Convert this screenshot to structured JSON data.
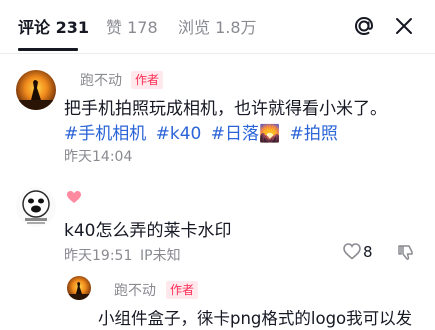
{
  "header": {
    "tabs": [
      {
        "label": "评论 231",
        "active": true
      },
      {
        "label": "赞 178",
        "active": false
      },
      {
        "label": "浏览 1.8万",
        "active": false
      }
    ],
    "icons": {
      "at": "at-icon",
      "close": "close-icon"
    }
  },
  "comments": [
    {
      "author": "跑不动",
      "author_tag": "作者",
      "text": "把手机拍照玩成相机，也许就得看小米了。",
      "hashtags": [
        "#手机相机",
        "#k40",
        "#日落🌄",
        "#拍照"
      ],
      "time": "昨天14:04"
    },
    {
      "avatar_icon": "meme-face-icon",
      "author": "",
      "text": "k40怎么弄的莱卡水印",
      "time": "昨天19:51",
      "location": "IP未知",
      "like_count": "8"
    }
  ],
  "reply": {
    "author": "跑不动",
    "author_tag": "作者",
    "text": "小组件盒子，徕卡png格式的logo我可以发"
  },
  "colors": {
    "accent": "#fe2c55",
    "hashtag": "#2b64d7",
    "muted": "#8a8b91",
    "text": "#161823"
  }
}
